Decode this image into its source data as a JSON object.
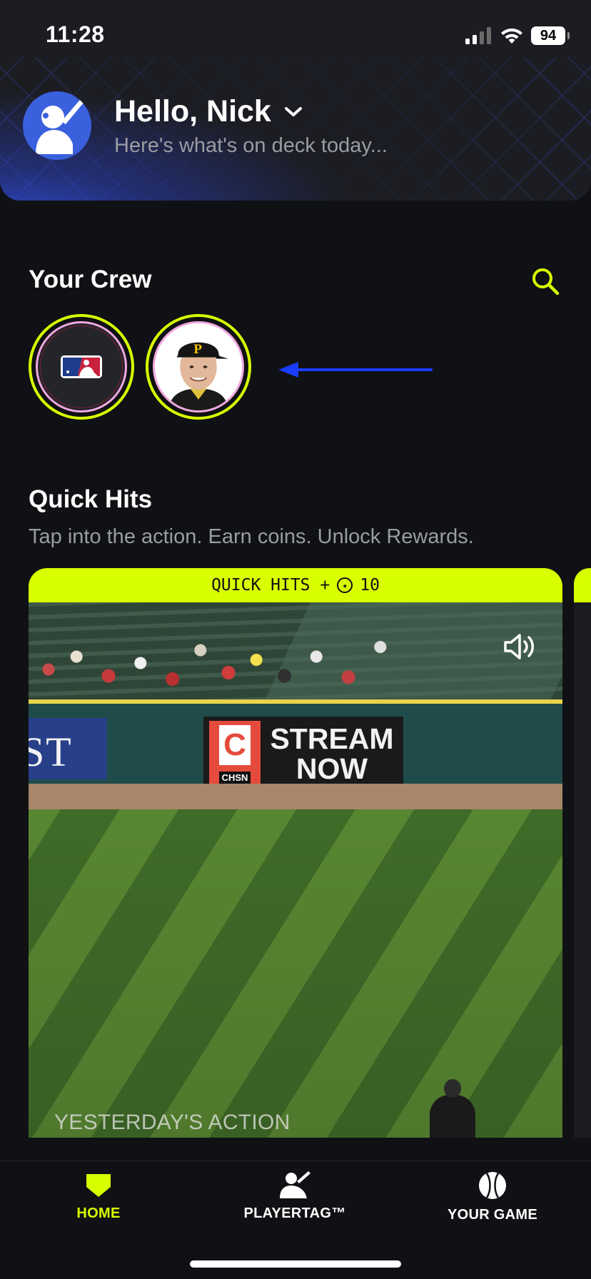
{
  "status_bar": {
    "time": "11:28",
    "battery": "94"
  },
  "header": {
    "greeting": "Hello, Nick",
    "subtitle": "Here's what's on deck today..."
  },
  "crew": {
    "title": "Your Crew",
    "items": [
      {
        "name": "mlb-logo"
      },
      {
        "name": "pirates-player"
      }
    ]
  },
  "quick_hits": {
    "title": "Quick Hits",
    "subtitle": "Tap into the action. Earn coins. Unlock Rewards.",
    "card": {
      "banner_label": "QUICK HITS +",
      "coins": "10",
      "caption": "YESTERDAY'S ACTION",
      "ad_text_line1": "STREAM",
      "ad_text_line2": "NOW",
      "ad_logo_sub": "CHSN",
      "wall_text": "ST"
    }
  },
  "tabs": [
    {
      "label": "HOME",
      "active": true
    },
    {
      "label": "PLAYERTAG™",
      "active": false
    },
    {
      "label": "YOUR GAME",
      "active": false
    }
  ],
  "colors": {
    "accent": "#d8ff00",
    "background": "#101114",
    "avatar_blue": "#3a60dd",
    "annotation_arrow": "#1a3cff"
  }
}
